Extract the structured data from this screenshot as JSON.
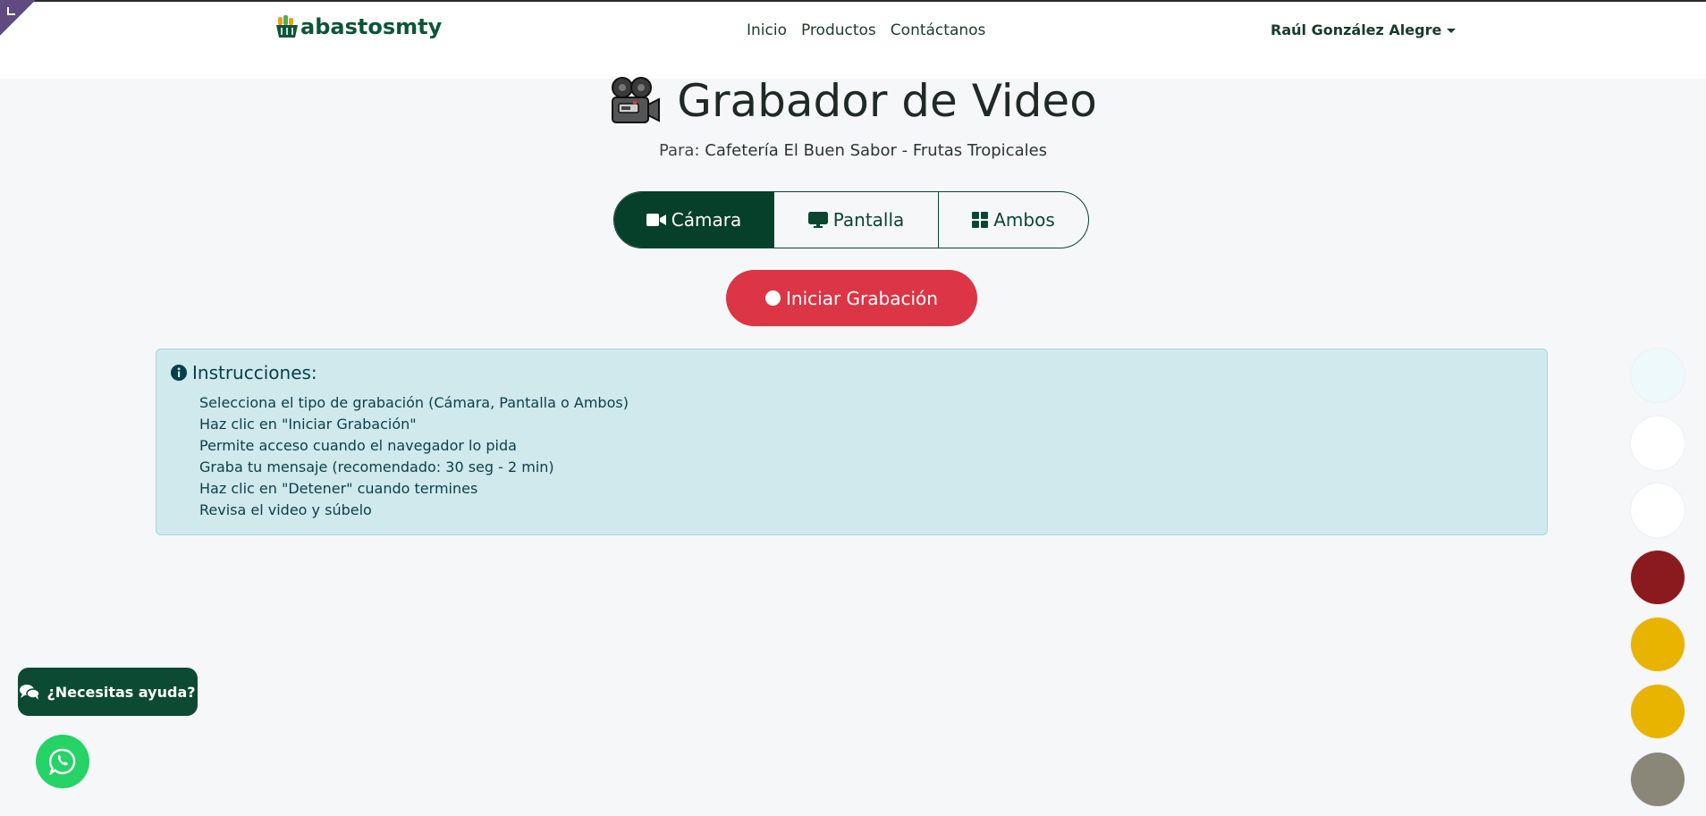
{
  "brand": {
    "name": "abastosmty"
  },
  "nav": {
    "links": [
      "Inicio",
      "Productos",
      "Contáctanos"
    ],
    "user": "Raúl González Alegre"
  },
  "page": {
    "title": "Grabador de Video",
    "subtitle_prefix": "Para:",
    "subtitle_name": "Cafetería El Buen Sabor - Frutas Tropicales"
  },
  "modes": {
    "camera": "Cámara",
    "screen": "Pantalla",
    "both": "Ambos",
    "selected": "Cámara"
  },
  "record_button": "Iniciar Grabación",
  "instructions": {
    "heading": "Instrucciones:",
    "steps": [
      "Selecciona el tipo de grabación (Cámara, Pantalla o Ambos)",
      "Haz clic en \"Iniciar Grabación\"",
      "Permite acceso cuando el navegador lo pida",
      "Graba tu mensaje (recomendado: 30 seg - 2 min)",
      "Haz clic en \"Detener\" cuando termines",
      "Revisa el video y súbelo"
    ]
  },
  "help_button": "¿Necesitas ayuda?",
  "icons": {
    "brand": "basket-icon",
    "title": "movie-camera-icon",
    "camera": "video-icon",
    "screen": "desktop-icon",
    "both": "grid-icon",
    "record": "record-dot-icon",
    "info": "info-circle-icon",
    "help": "chat-bubbles-icon",
    "whatsapp": "whatsapp-icon"
  },
  "side_buttons": [
    "#eef9fb",
    "#ffffff",
    "#ffffff",
    "#8b1a1f",
    "#e8b400",
    "#e8b400",
    "#8a8678"
  ],
  "colors": {
    "accent": "#063f2a",
    "record": "#dc3545",
    "info_bg": "#cfe9ed",
    "whatsapp": "#25d366"
  }
}
